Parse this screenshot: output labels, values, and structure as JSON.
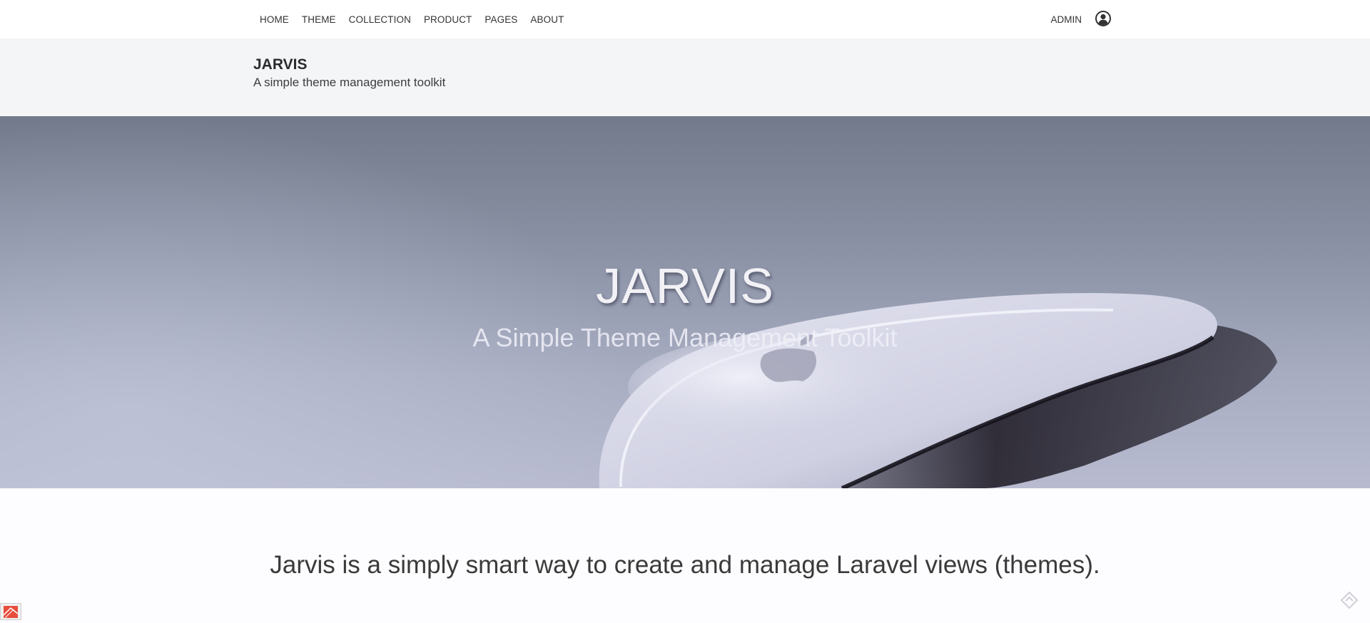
{
  "nav": {
    "items": [
      {
        "label": "HOME"
      },
      {
        "label": "THEME"
      },
      {
        "label": "COLLECTION"
      },
      {
        "label": "PRODUCT"
      },
      {
        "label": "PAGES"
      },
      {
        "label": "ABOUT"
      }
    ],
    "admin_label": "ADMIN",
    "user_icon": "user-circle-icon"
  },
  "brand": {
    "title": "JARVIS",
    "subtitle": "A simple theme management toolkit"
  },
  "hero": {
    "title": "JARVIS",
    "subtitle": "A Simple Theme Management Toolkit"
  },
  "intro": {
    "text": "Jarvis is a simply smart way to create and manage Laravel views (themes)."
  },
  "widgets": {
    "left_icon": "debugbar-icon",
    "right_icon": "diamond-arrow-icon"
  },
  "colors": {
    "nav_bg": "#ffffff",
    "brand_bg": "#f3f5f7",
    "hero_top": "#727a8b",
    "hero_bottom": "#b8bbd0",
    "page_bg": "#fdfcfe",
    "debug_red": "#e74c3c"
  }
}
